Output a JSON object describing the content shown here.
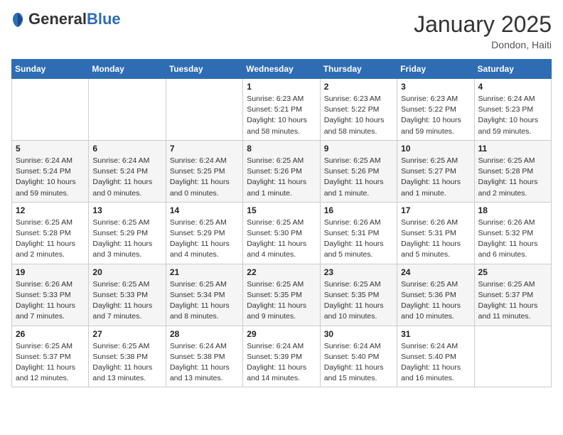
{
  "logo": {
    "general": "General",
    "blue": "Blue"
  },
  "title": {
    "month_year": "January 2025",
    "location": "Dondon, Haiti"
  },
  "weekdays": [
    "Sunday",
    "Monday",
    "Tuesday",
    "Wednesday",
    "Thursday",
    "Friday",
    "Saturday"
  ],
  "weeks": [
    [
      {
        "day": "",
        "info": ""
      },
      {
        "day": "",
        "info": ""
      },
      {
        "day": "",
        "info": ""
      },
      {
        "day": "1",
        "info": "Sunrise: 6:23 AM\nSunset: 5:21 PM\nDaylight: 10 hours and 58 minutes."
      },
      {
        "day": "2",
        "info": "Sunrise: 6:23 AM\nSunset: 5:22 PM\nDaylight: 10 hours and 58 minutes."
      },
      {
        "day": "3",
        "info": "Sunrise: 6:23 AM\nSunset: 5:22 PM\nDaylight: 10 hours and 59 minutes."
      },
      {
        "day": "4",
        "info": "Sunrise: 6:24 AM\nSunset: 5:23 PM\nDaylight: 10 hours and 59 minutes."
      }
    ],
    [
      {
        "day": "5",
        "info": "Sunrise: 6:24 AM\nSunset: 5:24 PM\nDaylight: 10 hours and 59 minutes."
      },
      {
        "day": "6",
        "info": "Sunrise: 6:24 AM\nSunset: 5:24 PM\nDaylight: 11 hours and 0 minutes."
      },
      {
        "day": "7",
        "info": "Sunrise: 6:24 AM\nSunset: 5:25 PM\nDaylight: 11 hours and 0 minutes."
      },
      {
        "day": "8",
        "info": "Sunrise: 6:25 AM\nSunset: 5:26 PM\nDaylight: 11 hours and 1 minute."
      },
      {
        "day": "9",
        "info": "Sunrise: 6:25 AM\nSunset: 5:26 PM\nDaylight: 11 hours and 1 minute."
      },
      {
        "day": "10",
        "info": "Sunrise: 6:25 AM\nSunset: 5:27 PM\nDaylight: 11 hours and 1 minute."
      },
      {
        "day": "11",
        "info": "Sunrise: 6:25 AM\nSunset: 5:28 PM\nDaylight: 11 hours and 2 minutes."
      }
    ],
    [
      {
        "day": "12",
        "info": "Sunrise: 6:25 AM\nSunset: 5:28 PM\nDaylight: 11 hours and 2 minutes."
      },
      {
        "day": "13",
        "info": "Sunrise: 6:25 AM\nSunset: 5:29 PM\nDaylight: 11 hours and 3 minutes."
      },
      {
        "day": "14",
        "info": "Sunrise: 6:25 AM\nSunset: 5:29 PM\nDaylight: 11 hours and 4 minutes."
      },
      {
        "day": "15",
        "info": "Sunrise: 6:25 AM\nSunset: 5:30 PM\nDaylight: 11 hours and 4 minutes."
      },
      {
        "day": "16",
        "info": "Sunrise: 6:26 AM\nSunset: 5:31 PM\nDaylight: 11 hours and 5 minutes."
      },
      {
        "day": "17",
        "info": "Sunrise: 6:26 AM\nSunset: 5:31 PM\nDaylight: 11 hours and 5 minutes."
      },
      {
        "day": "18",
        "info": "Sunrise: 6:26 AM\nSunset: 5:32 PM\nDaylight: 11 hours and 6 minutes."
      }
    ],
    [
      {
        "day": "19",
        "info": "Sunrise: 6:26 AM\nSunset: 5:33 PM\nDaylight: 11 hours and 7 minutes."
      },
      {
        "day": "20",
        "info": "Sunrise: 6:25 AM\nSunset: 5:33 PM\nDaylight: 11 hours and 7 minutes."
      },
      {
        "day": "21",
        "info": "Sunrise: 6:25 AM\nSunset: 5:34 PM\nDaylight: 11 hours and 8 minutes."
      },
      {
        "day": "22",
        "info": "Sunrise: 6:25 AM\nSunset: 5:35 PM\nDaylight: 11 hours and 9 minutes."
      },
      {
        "day": "23",
        "info": "Sunrise: 6:25 AM\nSunset: 5:35 PM\nDaylight: 11 hours and 10 minutes."
      },
      {
        "day": "24",
        "info": "Sunrise: 6:25 AM\nSunset: 5:36 PM\nDaylight: 11 hours and 10 minutes."
      },
      {
        "day": "25",
        "info": "Sunrise: 6:25 AM\nSunset: 5:37 PM\nDaylight: 11 hours and 11 minutes."
      }
    ],
    [
      {
        "day": "26",
        "info": "Sunrise: 6:25 AM\nSunset: 5:37 PM\nDaylight: 11 hours and 12 minutes."
      },
      {
        "day": "27",
        "info": "Sunrise: 6:25 AM\nSunset: 5:38 PM\nDaylight: 11 hours and 13 minutes."
      },
      {
        "day": "28",
        "info": "Sunrise: 6:24 AM\nSunset: 5:38 PM\nDaylight: 11 hours and 13 minutes."
      },
      {
        "day": "29",
        "info": "Sunrise: 6:24 AM\nSunset: 5:39 PM\nDaylight: 11 hours and 14 minutes."
      },
      {
        "day": "30",
        "info": "Sunrise: 6:24 AM\nSunset: 5:40 PM\nDaylight: 11 hours and 15 minutes."
      },
      {
        "day": "31",
        "info": "Sunrise: 6:24 AM\nSunset: 5:40 PM\nDaylight: 11 hours and 16 minutes."
      },
      {
        "day": "",
        "info": ""
      }
    ]
  ]
}
